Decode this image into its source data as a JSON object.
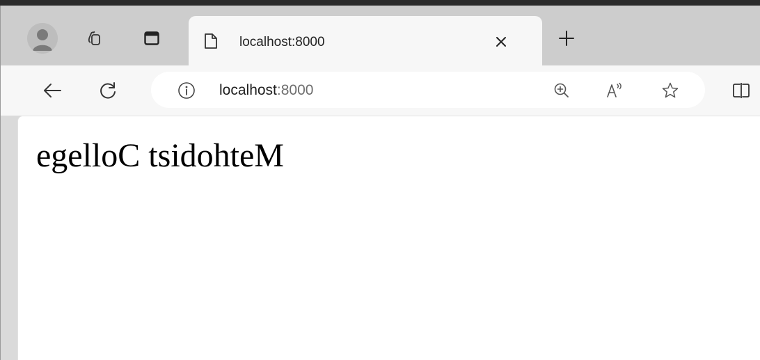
{
  "tab": {
    "title": "localhost:8000"
  },
  "address_bar": {
    "host": "localhost",
    "port": ":8000"
  },
  "page": {
    "heading": "egelloC tsidohteM"
  },
  "icons": {
    "profile": "avatar-icon",
    "workspaces": "workspaces-icon",
    "tab_actions": "tab-actions-icon",
    "favicon": "page-icon",
    "close": "close-icon",
    "new_tab": "plus-icon",
    "back": "back-arrow-icon",
    "refresh": "refresh-icon",
    "site_info": "info-icon",
    "zoom": "zoom-in-icon",
    "read_aloud": "read-aloud-icon",
    "favorite": "star-icon",
    "split_screen": "split-screen-icon"
  }
}
